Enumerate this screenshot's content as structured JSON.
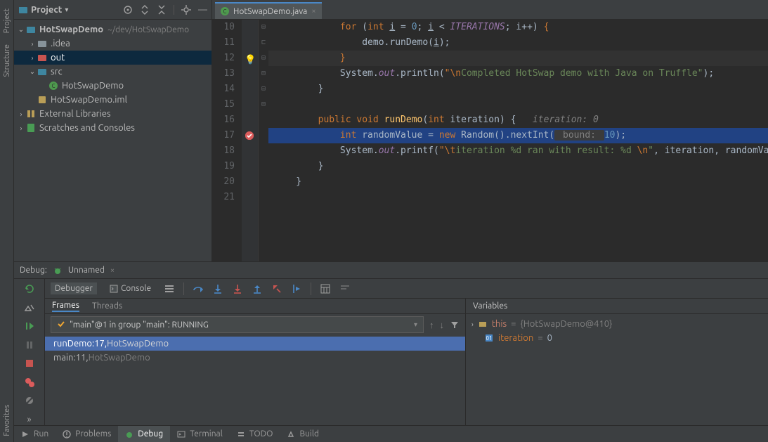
{
  "project_panel": {
    "title": "Project",
    "tree": {
      "root": {
        "label": "HotSwapDemo",
        "path": "~/dev/HotSwapDemo"
      },
      "idea": ".idea",
      "out": "out",
      "src": "src",
      "hotswapdemo": "HotSwapDemo",
      "iml": "HotSwapDemo.iml",
      "ext": "External Libraries",
      "scratch": "Scratches and Consoles"
    }
  },
  "editor": {
    "tab": "HotSwapDemo.java",
    "lines": {
      "start": 10,
      "end": 21
    }
  },
  "code": {
    "for_kw": "for",
    "int_kw": "int",
    "public_kw": "public",
    "void_kw": "void",
    "new_kw": "new",
    "i": "i",
    "zero": "0",
    "iter_const": "ITERATIONS",
    "ipp": "i++",
    "demo": "demo",
    "rundemo": "runDemo",
    "system": "System",
    "out": "out",
    "println": "println",
    "printf": "printf",
    "string1_esc": "\"\\n",
    "string1_body": "Completed HotSwap demo with Java on Truffle\"",
    "rundemo_def": "runDemo",
    "iteration_p": "iteration",
    "iter_hint": "iteration: 0",
    "randomValue": "randomValue",
    "random_cls": "Random",
    "nextInt": "nextInt",
    "bound_hint": "bound:",
    "ten": "10",
    "tpl_esc1": "\"\\t",
    "tpl_body1": "iteration %d ran with result: %d ",
    "tpl_esc2": "\\n",
    "tpl_close": "\""
  },
  "debug": {
    "title_label": "Debug:",
    "config": "Unnamed",
    "tabs": {
      "debugger": "Debugger",
      "console": "Console"
    },
    "frames_tab": "Frames",
    "threads_tab": "Threads",
    "vars_tab": "Variables",
    "thread_select": "\"main\"@1 in group \"main\": RUNNING",
    "frames": [
      {
        "method": "runDemo:17",
        "owner": "HotSwapDemo"
      },
      {
        "method": "main:11",
        "owner": "HotSwapDemo"
      }
    ],
    "vars": {
      "this_name": "this",
      "this_val": "{HotSwapDemo@410}",
      "iter_name": "iteration",
      "iter_val": "0"
    }
  },
  "bottom": {
    "run": "Run",
    "problems": "Problems",
    "debug": "Debug",
    "terminal": "Terminal",
    "todo": "TODO",
    "build": "Build"
  }
}
